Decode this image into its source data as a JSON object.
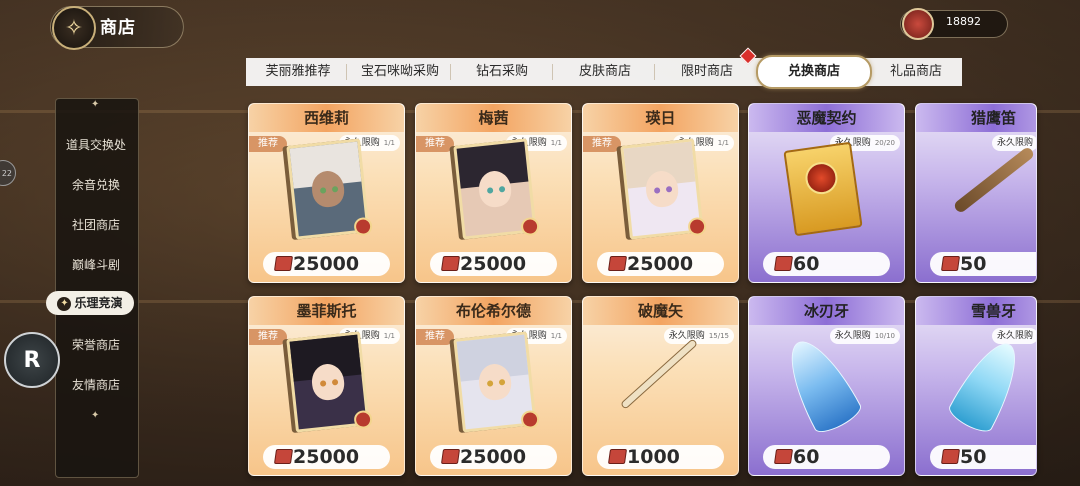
{
  "header": {
    "title": "商店",
    "currency_value": "18892"
  },
  "tabs": [
    "芙丽雅推荐",
    "宝石咪呦采购",
    "钻石采购",
    "皮肤商店",
    "限时商店",
    "兑换商店",
    "礼品商店"
  ],
  "active_tab": "兑换商店",
  "sidebar": {
    "items": [
      "道具交换处",
      "余音兑换",
      "社团商店",
      "巅峰斗剧",
      "乐理竞演",
      "荣誉商店",
      "友情商店"
    ],
    "active": "乐理竞演"
  },
  "left_buttons": {
    "edge_bubble": "22",
    "r_button": "R"
  },
  "cards": [
    {
      "name": "西维莉",
      "tag": "推荐",
      "limit": "永久限购",
      "count": "1/1",
      "price": "25000",
      "theme": "orange",
      "art": "character-card"
    },
    {
      "name": "梅茜",
      "tag": "推荐",
      "limit": "永久限购",
      "count": "1/1",
      "price": "25000",
      "theme": "orange",
      "art": "character-card"
    },
    {
      "name": "瑛日",
      "tag": "推荐",
      "limit": "永久限购",
      "count": "1/1",
      "price": "25000",
      "theme": "orange",
      "art": "character-card"
    },
    {
      "name": "恶魔契约",
      "tag": "",
      "limit": "永久限购",
      "count": "20/20",
      "price": "60",
      "theme": "purple",
      "art": "contract"
    },
    {
      "name": "猎鹰笛",
      "tag": "",
      "limit": "永久限购",
      "count": "",
      "price": "50",
      "theme": "purple",
      "art": "flute"
    },
    {
      "name": "墨菲斯托",
      "tag": "推荐",
      "limit": "永久限购",
      "count": "1/1",
      "price": "25000",
      "theme": "orange",
      "art": "character-card"
    },
    {
      "name": "布伦希尔德",
      "tag": "推荐",
      "limit": "永久限购",
      "count": "1/1",
      "price": "25000",
      "theme": "orange",
      "art": "character-card"
    },
    {
      "name": "破魔矢",
      "tag": "",
      "limit": "永久限购",
      "count": "15/15",
      "price": "1000",
      "theme": "orange",
      "art": "arrow"
    },
    {
      "name": "冰刃牙",
      "tag": "",
      "limit": "永久限购",
      "count": "10/10",
      "price": "60",
      "theme": "purple",
      "art": "ice-fang"
    },
    {
      "name": "雪兽牙",
      "tag": "",
      "limit": "永久限购",
      "count": "",
      "price": "50",
      "theme": "purple",
      "art": "snow-fang"
    }
  ],
  "colors": {
    "orange_card": "#f7c58a",
    "purple_card": "#8b6fcf",
    "price_icon": "#c5463a",
    "tab_accent": "#b59a64"
  }
}
